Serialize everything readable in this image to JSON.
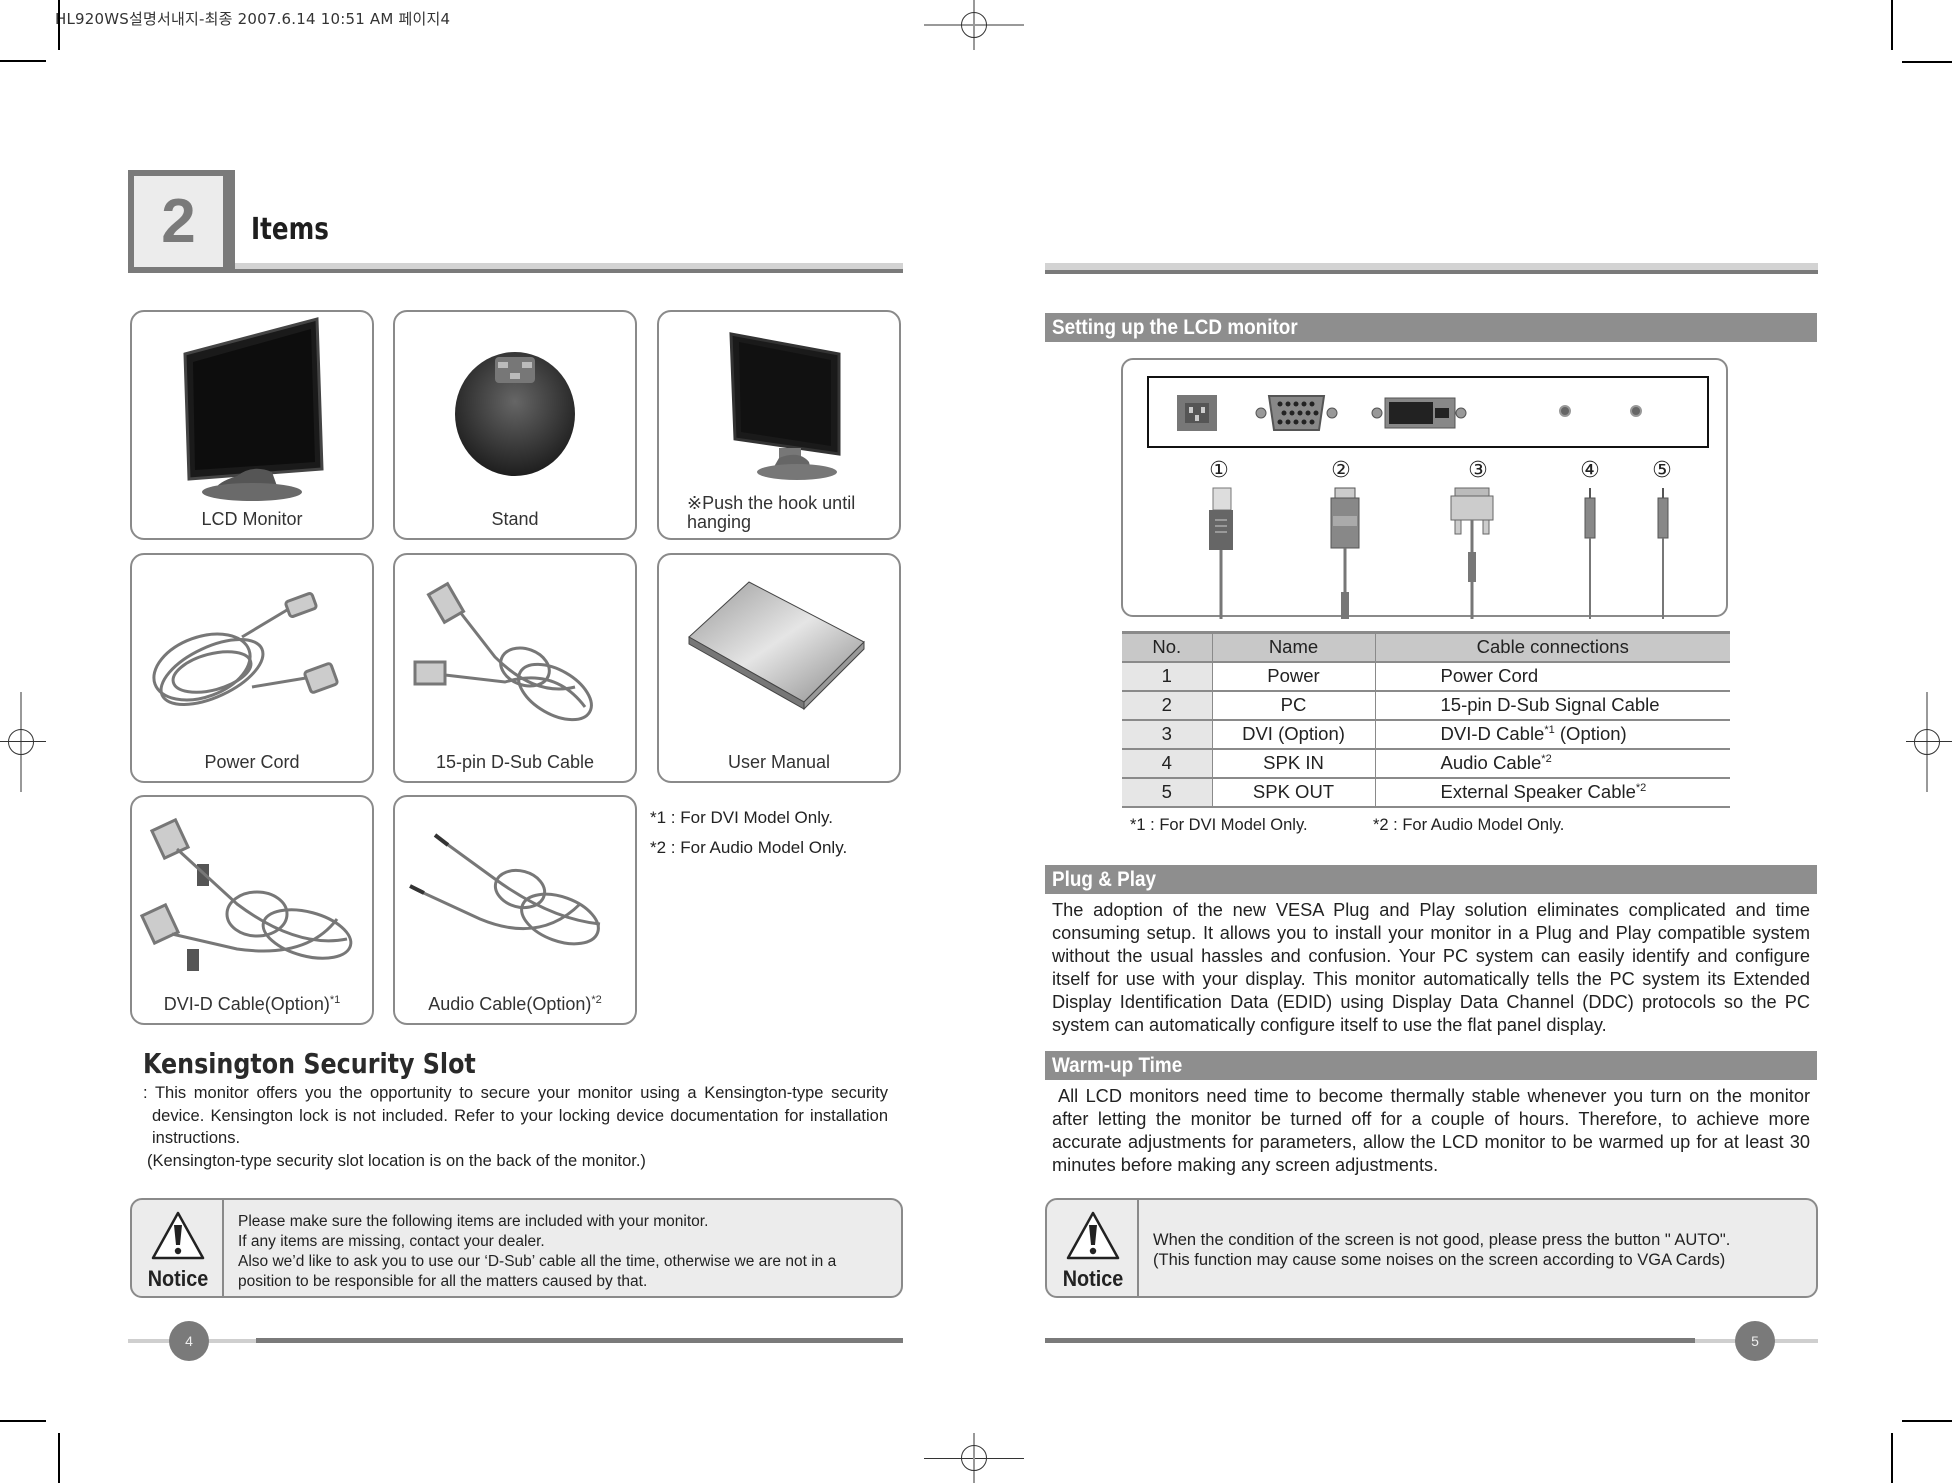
{
  "print_header": "HL920WS설명서내지-최종  2007.6.14 10:51 AM 페이지4",
  "section": {
    "number": "2",
    "title": "Items"
  },
  "items": [
    {
      "label": "LCD Monitor",
      "sup": "",
      "icon": "lcd-monitor-image"
    },
    {
      "label": "Stand",
      "sup": "",
      "icon": "stand-image"
    },
    {
      "label": "※Push the hook until hanging",
      "sup": "",
      "icon": "monitor-hook-image"
    },
    {
      "label": "Power Cord",
      "sup": "",
      "icon": "power-cord-image"
    },
    {
      "label": "15-pin D-Sub Cable",
      "sup": "",
      "icon": "dsub-cable-image"
    },
    {
      "label": "User Manual",
      "sup": "",
      "icon": "user-manual-image"
    },
    {
      "label": "DVI-D Cable(Option)",
      "sup": "*1",
      "icon": "dvi-cable-image"
    },
    {
      "label": "Audio Cable(Option)",
      "sup": "*2",
      "icon": "audio-cable-image"
    }
  ],
  "item_footnotes": [
    "*1 : For DVI Model Only.",
    "*2 : For Audio Model Only."
  ],
  "kensington": {
    "title": "Kensington Security Slot",
    "text": ": This monitor offers you the opportunity  to secure your monitor using a Kensington-type security device. Kensington lock is not included. Refer to your locking device documentation for installation instructions.",
    "note": "(Kensington-type security slot location is on the back of the monitor.)"
  },
  "notice_left": {
    "label": "Notice",
    "lines": [
      "Please make sure the following items are included with your monitor.",
      "If any items are missing, contact your dealer.",
      "Also we’d like to ask you to use our ‘D-Sub’ cable all the time, otherwise we are not in a position to be responsible for all the matters caused by that."
    ]
  },
  "page_left": "4",
  "page_right": "5",
  "setup": {
    "title": "Setting up the LCD monitor",
    "port_numbers": [
      "①",
      "②",
      "③",
      "④",
      "⑤"
    ],
    "table": {
      "headers": [
        "No.",
        "Name",
        "Cable connections"
      ],
      "rows": [
        {
          "no": "1",
          "name": "Power",
          "cable": "Power Cord",
          "sup": "",
          "suffix": ""
        },
        {
          "no": "2",
          "name": "PC",
          "cable": "15-pin D-Sub Signal Cable",
          "sup": "",
          "suffix": ""
        },
        {
          "no": "3",
          "name": "DVI (Option)",
          "cable": "DVI-D Cable",
          "sup": "*1",
          "suffix": " (Option)"
        },
        {
          "no": "4",
          "name": "SPK IN",
          "cable": "Audio Cable",
          "sup": "*2",
          "suffix": ""
        },
        {
          "no": "5",
          "name": "SPK OUT",
          "cable": "External Speaker Cable",
          "sup": "*2",
          "suffix": ""
        }
      ]
    },
    "footnote1": "*1 : For DVI Model Only.",
    "footnote2": "*2 : For Audio Model Only."
  },
  "plug_and_play": {
    "title": "Plug & Play",
    "text": "The adoption of the new VESA Plug and Play solution eliminates complicated and time consuming setup. It allows you to install your monitor in a Plug and Play compatible system without the usual hassles and confusion. Your PC system can easily identify and configure itself for use with your display. This monitor automatically tells the PC system its Extended Display Identification Data (EDID) using Display Data Channel (DDC) protocols so the PC system can automatically configure itself to use the flat panel display."
  },
  "warmup": {
    "title": "Warm-up Time",
    "text": "All LCD monitors need time to become thermally stable whenever you turn on the monitor after letting the monitor be turned off for a couple of hours. Therefore, to achieve more accurate adjustments for parameters, allow the LCD monitor to be warmed up for at least 30 minutes before making any screen adjustments."
  },
  "notice_right": {
    "label": "Notice",
    "lines": [
      "When the condition of the screen is not good, please press the button \" AUTO\".",
      "(This function may cause some noises on the screen according to VGA Cards)"
    ]
  },
  "colors": {
    "band_gray": "#8e8e8e",
    "dark_gray": "#7a7a7a",
    "light_gray": "#d3d3d3",
    "notice_bg": "#ececec"
  }
}
